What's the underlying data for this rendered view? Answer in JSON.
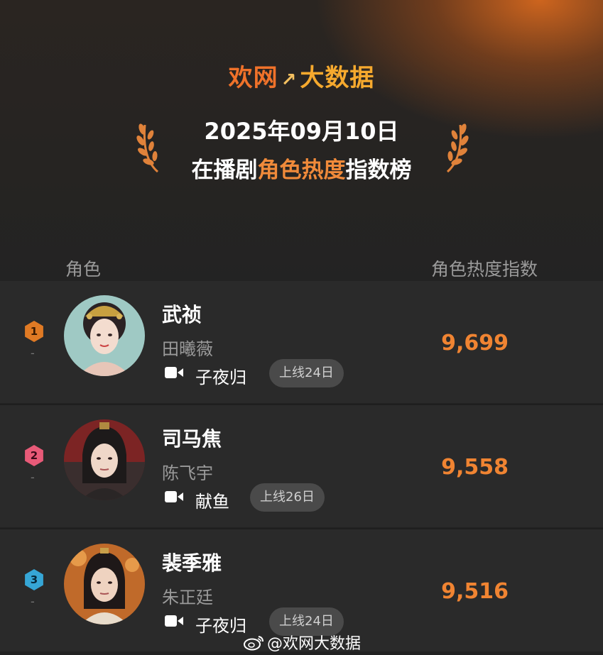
{
  "header": {
    "brand_part1": "欢网",
    "brand_mark": "↗",
    "brand_part2": "大数据",
    "date": "2025年09月10日",
    "subtitle_prefix": "在播剧",
    "subtitle_highlight": "角色热度",
    "subtitle_suffix": "指数榜"
  },
  "columns": {
    "left": "角色",
    "right": "角色热度指数"
  },
  "rows": [
    {
      "rank": "1",
      "trend": "-",
      "character": "武祯",
      "actor": "田曦薇",
      "show": "子夜归",
      "online": "上线24日",
      "score": "9,699",
      "badge_color": "#e07a24"
    },
    {
      "rank": "2",
      "trend": "-",
      "character": "司马焦",
      "actor": "陈飞宇",
      "show": "献鱼",
      "online": "上线26日",
      "score": "9,558",
      "badge_color": "#e85a78"
    },
    {
      "rank": "3",
      "trend": "-",
      "character": "裴季雅",
      "actor": "朱正廷",
      "show": "子夜归",
      "online": "上线24日",
      "score": "9,516",
      "badge_color": "#36a6d6"
    }
  ],
  "watermark": "@欢网大数据",
  "icons": {
    "laurel": "laurel-icon",
    "video": "video-camera-icon",
    "weibo": "weibo-icon"
  },
  "colors": {
    "accent": "#f08432",
    "background": "#222222",
    "row": "#2a2a2a"
  }
}
